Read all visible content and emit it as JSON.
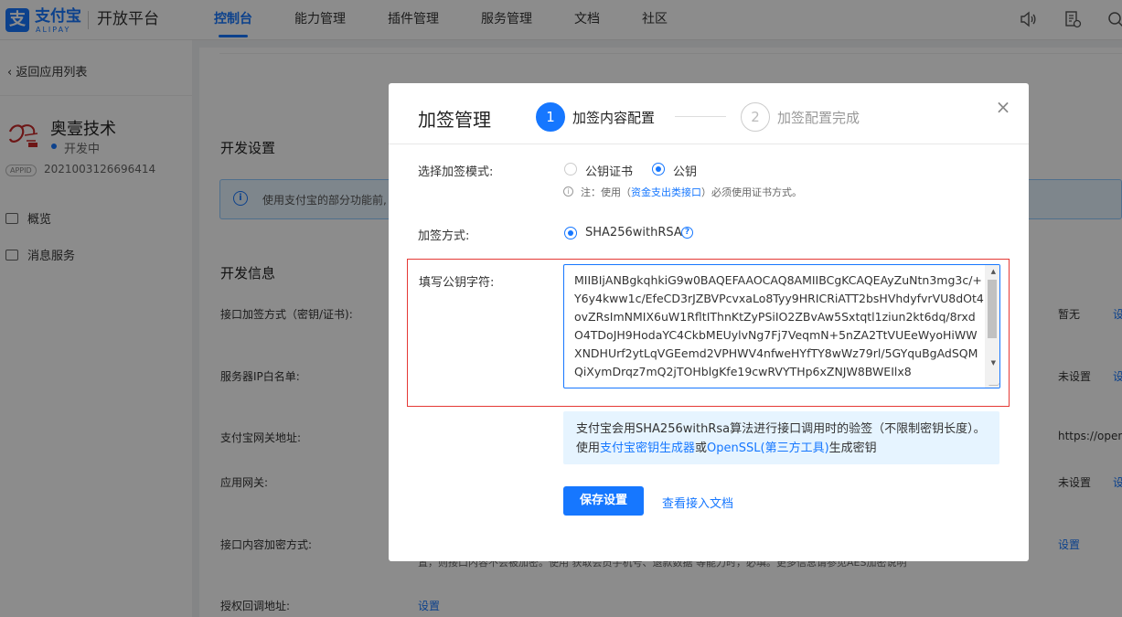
{
  "header": {
    "logo_mark": "支",
    "logo_cn": "支付宝",
    "logo_en": "ALIPAY",
    "platform": "开放平台",
    "nav": [
      "控制台",
      "能力管理",
      "插件管理",
      "服务管理",
      "文档",
      "社区"
    ],
    "active_nav": 0,
    "accent": "#1677ff"
  },
  "sidebar": {
    "back_label": "返回应用列表",
    "app_name": "奥壹技术",
    "app_status": "开发中",
    "appid_badge": "APPID",
    "appid_value": "2021003126696414",
    "menu": [
      "概览",
      "消息服务"
    ]
  },
  "main": {
    "dev_settings_title": "开发设置",
    "info_banner": "使用支付宝的部分功能前,",
    "dev_info_title": "开发信息",
    "rows": [
      {
        "label": "接口加签方式（密钥/证书):",
        "value": "暂无",
        "link": "设"
      },
      {
        "label": "服务器IP白名单:",
        "value": "未设置",
        "link": "设"
      },
      {
        "label": "支付宝网关地址:",
        "value": "https://opena"
      },
      {
        "label": "应用网关:",
        "value": "未设置",
        "link": "设"
      },
      {
        "label": "接口内容加密方式:",
        "link": "设置"
      },
      {
        "label": "授权回调地址:",
        "link": "设置"
      }
    ],
    "behind_text": "置，则接口内容不会被加密。使用 获取会员手机号、退款数据 等能力时，必填。更多信息请参见AES加密说明"
  },
  "modal": {
    "title": "加签管理",
    "steps": [
      {
        "num": "1",
        "label": "加签内容配置"
      },
      {
        "num": "2",
        "label": "加签配置完成"
      }
    ],
    "close_icon": "×",
    "mode_label": "选择加签模式:",
    "mode_options": [
      "公钥证书",
      "公钥"
    ],
    "mode_selected": 1,
    "note_prefix": "注：使用（",
    "note_link": "资金支出类接口",
    "note_suffix": "）必须使用证书方式。",
    "method_label": "加签方式:",
    "method_value": "SHA256withRSA",
    "key_label": "填写公钥字符:",
    "key_value": "MIIBIjANBgkqhkiG9w0BAQEFAAOCAQ8AMIIBCgKCAQEAyZuNtn3mg3c/+Y6y4kww1c/EfeCD3rJZBVPcvxaLo8Tyy9HRICRiATT2bsHVhdyfvrVU8dOt4ovZRsImNMIX6uW1RfltIThnKtZyPSiIO2ZBvAw5Sxtqtl1ziun2kt6dq/8rxdO4TDoJH9HodaYC4CkbMEUylvNg7Fj7VeqmN+5nZA2TtVUEeWyoHiWWXNDHUrf2ytLqVGEemd2VPHWV4nfweHYfTY8wWz79rl/5GYquBgAdSQMQiXymDrqz7mQ2jTOHblgKfe19cwRVYTHp6xZNJW8BWEIlx8",
    "tip_prefix": "支付宝会用SHA256withRsa算法进行接口调用时的验签（不限制密钥长度）。使用",
    "tip_link1": "支付宝密钥生成器",
    "tip_mid": "或",
    "tip_link2": "OpenSSL(第三方工具)",
    "tip_suffix": "生成密钥",
    "save_label": "保存设置",
    "doc_link": "查看接入文档",
    "highlight_color": "#e53935"
  }
}
